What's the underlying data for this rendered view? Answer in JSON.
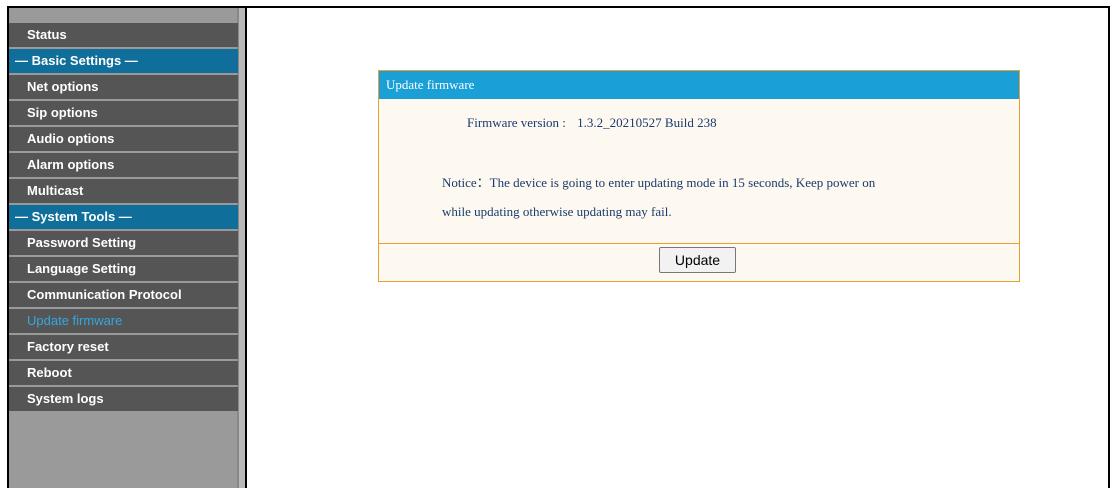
{
  "sidebar": {
    "items": [
      {
        "label": "Status",
        "type": "item"
      },
      {
        "label": "— Basic Settings —",
        "type": "section"
      },
      {
        "label": "Net options",
        "type": "item"
      },
      {
        "label": "Sip options",
        "type": "item"
      },
      {
        "label": "Audio options",
        "type": "item"
      },
      {
        "label": "Alarm options",
        "type": "item"
      },
      {
        "label": "Multicast",
        "type": "item"
      },
      {
        "label": "— System Tools —",
        "type": "section"
      },
      {
        "label": "Password Setting",
        "type": "item"
      },
      {
        "label": "Language Setting",
        "type": "item"
      },
      {
        "label": "Communication Protocol",
        "type": "item"
      },
      {
        "label": "Update firmware",
        "type": "active"
      },
      {
        "label": "Factory reset",
        "type": "item"
      },
      {
        "label": "Reboot",
        "type": "item"
      },
      {
        "label": "System logs",
        "type": "item"
      }
    ]
  },
  "panel": {
    "title": "Update firmware",
    "firmware_label": "Firmware version :",
    "firmware_value": "1.3.2_20210527 Build 238",
    "notice_line1": "Notice：The device is going to enter updating mode in 15 seconds, Keep power on",
    "notice_line2": "while updating otherwise updating may fail.",
    "update_button": "Update"
  },
  "colors": {
    "section_bg": "#0f6f9a",
    "item_bg": "#555555",
    "active_text": "#35a7e0",
    "panel_header": "#1a9fd6",
    "panel_border": "#e8a032"
  }
}
